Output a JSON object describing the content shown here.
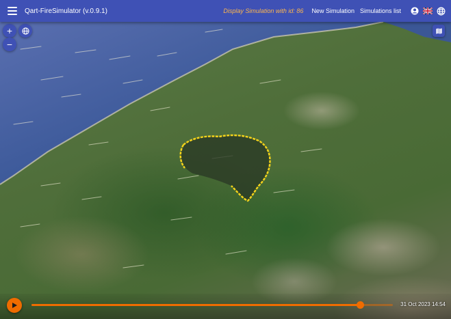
{
  "appbar": {
    "title": "Qart-FireSimulator (v.0.9.1)",
    "display_simulation": "Display Simulation with id: 86",
    "new_simulation": "New Simulation",
    "simulations_list": "Simulations list",
    "icons": [
      "menu-icon",
      "account-icon",
      "uk-flag-icon",
      "globe-icon"
    ],
    "bar_color": "#3f51b5",
    "accent_color": "#ffb74d"
  },
  "map_controls": {
    "zoom_in": "+",
    "zoom_out": "−",
    "icons": [
      "globe-icon",
      "map-icon"
    ]
  },
  "timeline": {
    "time_label": "31 Oct 2023 14:54",
    "progress": 0.91,
    "play_icon": "play-icon",
    "accent_color": "#ef6c00"
  },
  "fire": {
    "perimeter_color": "#f2d21b"
  }
}
